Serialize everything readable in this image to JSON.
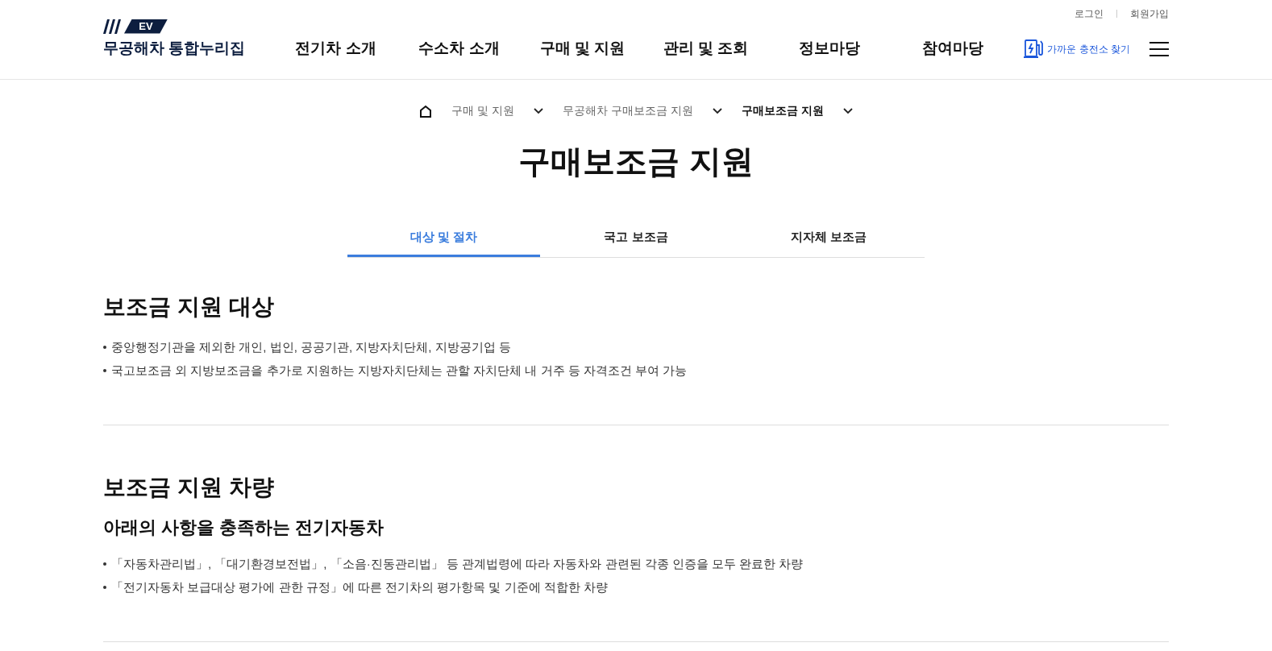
{
  "logo": {
    "badge": "EV",
    "name": "무공해차 통합누리집"
  },
  "util_links": [
    "로그인",
    "회원가입"
  ],
  "nav": [
    "전기차 소개",
    "수소차 소개",
    "구매 및 지원",
    "관리 및 조회",
    "정보마당",
    "참여마당"
  ],
  "charger_link": "가까운 충전소 찾기",
  "breadcrumb": [
    {
      "label": "구매 및 지원",
      "selected": false
    },
    {
      "label": "무공해차 구매보조금 지원",
      "selected": false
    },
    {
      "label": "구매보조금 지원",
      "selected": true
    }
  ],
  "page_title": "구매보조금 지원",
  "tabs": [
    {
      "label": "대상 및 절차",
      "selected": true
    },
    {
      "label": "국고 보조금",
      "selected": false
    },
    {
      "label": "지자체 보조금",
      "selected": false
    }
  ],
  "sections": [
    {
      "heading": "보조금 지원 대상",
      "bullets": [
        "중앙행정기관을 제외한 개인, 법인, 공공기관, 지방자치단체, 지방공기업 등",
        "국고보조금 외 지방보조금을 추가로 지원하는 지방자치단체는 관할 자치단체 내 거주 등 자격조건 부여 가능"
      ]
    },
    {
      "heading": "보조금 지원 차량",
      "subheading": "아래의 사항을 충족하는 전기자동차",
      "bullets": [
        "「자동차관리법」, 「대기환경보전법」, 「소음·진동관리법」 등 관계법령에 따라 자동차와 관련된 각종 인증을 모두 완료한 차량",
        "「전기자동차 보급대상 평가에 관한 규정」에 따른 전기차의 평가항목 및 기준에 적합한 차량"
      ]
    }
  ]
}
